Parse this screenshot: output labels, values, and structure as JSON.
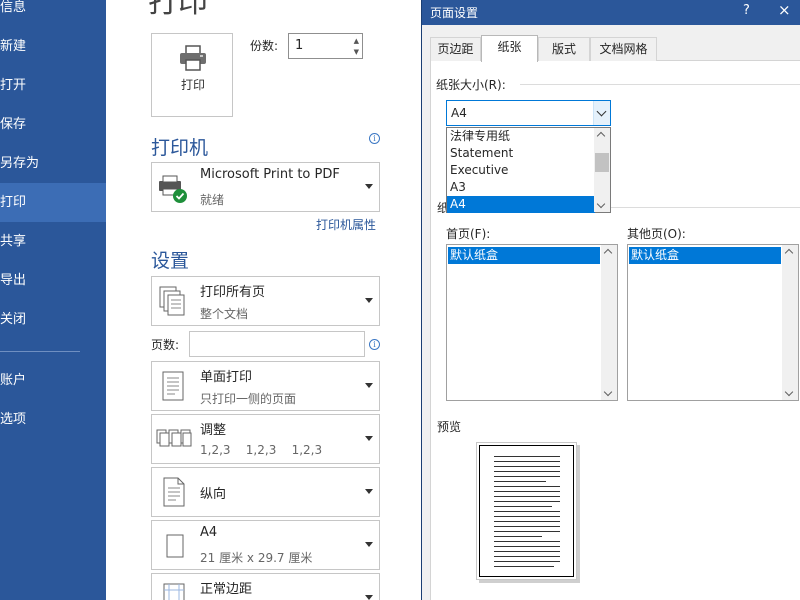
{
  "nav": {
    "items": [
      {
        "label": "信息"
      },
      {
        "label": "新建"
      },
      {
        "label": "打开"
      },
      {
        "label": "保存"
      },
      {
        "label": "另存为"
      },
      {
        "label": "打印",
        "active": true
      },
      {
        "label": "共享"
      },
      {
        "label": "导出"
      },
      {
        "label": "关闭"
      },
      {
        "label": "账户"
      },
      {
        "label": "选项"
      }
    ]
  },
  "print": {
    "title": "打印",
    "print_button_label": "打印",
    "copies_label": "份数:",
    "copies_value": "1",
    "printer_section_title": "打印机",
    "printer": {
      "name": "Microsoft Print to PDF",
      "status": "就绪"
    },
    "printer_properties_link": "打印机属性",
    "settings_section_title": "设置",
    "settings": [
      {
        "main": "打印所有页",
        "sub": "整个文档",
        "icon": "all-pages-icon"
      },
      {
        "main": "单面打印",
        "sub": "只打印一侧的页面",
        "icon": "one-sided-icon"
      },
      {
        "main": "调整",
        "sub": "1,2,3    1,2,3    1,2,3",
        "icon": "collated-icon"
      },
      {
        "main": "纵向",
        "sub": "",
        "icon": "portrait-icon"
      },
      {
        "main": "A4",
        "sub": "21 厘米 x 29.7 厘米",
        "icon": "paper-size-icon"
      },
      {
        "main": "正常边距",
        "sub": "",
        "icon": "margins-icon"
      }
    ],
    "pages_label": "页数:",
    "pages_value": ""
  },
  "dialog": {
    "title": "页面设置",
    "help": "?",
    "close": "×",
    "tabs": [
      {
        "label": "页边距"
      },
      {
        "label": "纸张",
        "active": true
      },
      {
        "label": "版式"
      },
      {
        "label": "文档网格"
      }
    ],
    "paper_size_label": "纸张大小(R):",
    "paper_size_value": "A4",
    "paper_size_options": [
      "法律专用纸",
      "Statement",
      "Executive",
      "A3",
      "A4"
    ],
    "paper_source_group_label": "纸",
    "first_page_label": "首页(F):",
    "other_pages_label": "其他页(O):",
    "first_page_selected": "默认纸盒",
    "other_pages_selected": "默认纸盒",
    "preview_label": "预览"
  },
  "colors": {
    "nav_bg": "#2b579a",
    "accent": "#2b579a",
    "selection": "#0078d7"
  }
}
